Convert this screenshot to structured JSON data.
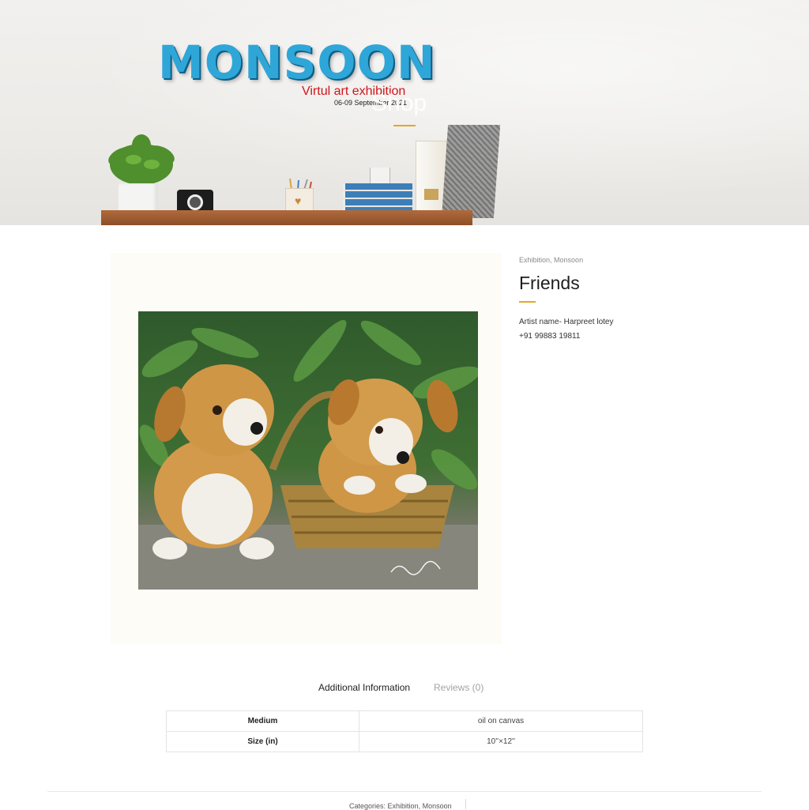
{
  "hero": {
    "logo_title": "MONSOON",
    "logo_subtitle": "Virtul art exhibition",
    "logo_date": "06-09 September 2021",
    "page_title": "Shop"
  },
  "product": {
    "categories": [
      "Exhibition",
      "Monsoon"
    ],
    "category_separator": ", ",
    "title": "Friends",
    "artist_line": "Artist name- Harpreet lotey",
    "phone_line": "+91 99883 19811",
    "image_alt": "Painting of two puppies with a wicker basket"
  },
  "tabs": [
    {
      "label": "Additional Information",
      "active": true
    },
    {
      "label": "Reviews (0)",
      "active": false
    }
  ],
  "attributes": [
    {
      "name": "Medium",
      "value": "oil on canvas"
    },
    {
      "name": "Size (in)",
      "value": "10''×12''"
    }
  ],
  "footer": {
    "categories_label": "Categories:",
    "categories": [
      "Exhibition",
      "Monsoon"
    ]
  },
  "colors": {
    "accent": "#e4a72a",
    "logo_blue": "#2fa6d8",
    "logo_red": "#d0141b"
  }
}
